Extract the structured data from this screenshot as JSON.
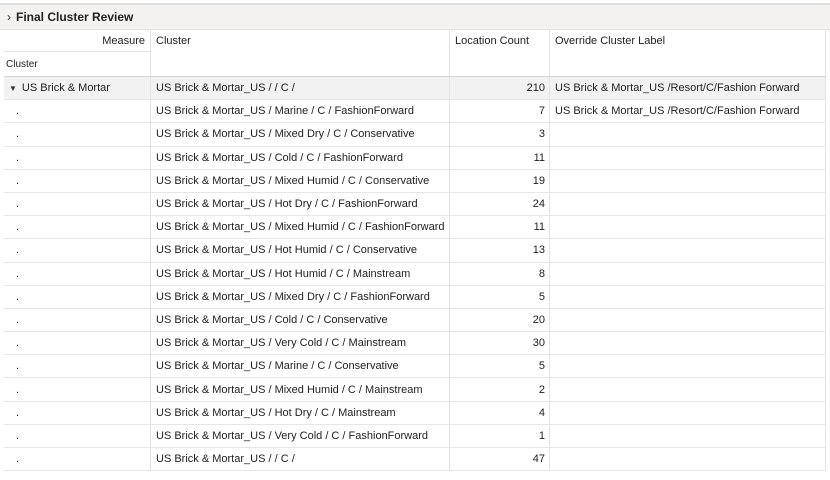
{
  "panel": {
    "chevron_icon": "chevron-right-icon",
    "title": "Final Cluster Review"
  },
  "table": {
    "measure_label": "Measure",
    "row_dim_label": "Cluster",
    "columns": [
      "Cluster",
      "Location Count",
      "Override Cluster Label"
    ],
    "group_label": "US Brick & Mortar",
    "group_toggle_icon": "caret-down-icon",
    "rows": [
      {
        "lead": "",
        "cluster": "US Brick & Mortar_US / / C /",
        "count": "210",
        "override": "US Brick & Mortar_US /Resort/C/Fashion Forward"
      },
      {
        "lead": ".",
        "cluster": "US Brick & Mortar_US / Marine / C / FashionForward",
        "count": "7",
        "override": "US Brick & Mortar_US /Resort/C/Fashion Forward"
      },
      {
        "lead": ".",
        "cluster": "US Brick & Mortar_US / Mixed Dry / C / Conservative",
        "count": "3",
        "override": ""
      },
      {
        "lead": ".",
        "cluster": "US Brick & Mortar_US / Cold / C / FashionForward",
        "count": "11",
        "override": ""
      },
      {
        "lead": ".",
        "cluster": "US Brick & Mortar_US / Mixed Humid / C / Conservative",
        "count": "19",
        "override": ""
      },
      {
        "lead": ".",
        "cluster": "US Brick & Mortar_US / Hot Dry / C / FashionForward",
        "count": "24",
        "override": ""
      },
      {
        "lead": ".",
        "cluster": "US Brick & Mortar_US / Mixed Humid / C / FashionForward",
        "count": "11",
        "override": ""
      },
      {
        "lead": ".",
        "cluster": "US Brick & Mortar_US / Hot Humid / C / Conservative",
        "count": "13",
        "override": ""
      },
      {
        "lead": ".",
        "cluster": "US Brick & Mortar_US / Hot Humid / C / Mainstream",
        "count": "8",
        "override": ""
      },
      {
        "lead": ".",
        "cluster": "US Brick & Mortar_US / Mixed Dry / C / FashionForward",
        "count": "5",
        "override": ""
      },
      {
        "lead": ".",
        "cluster": "US Brick & Mortar_US / Cold / C / Conservative",
        "count": "20",
        "override": ""
      },
      {
        "lead": ".",
        "cluster": "US Brick & Mortar_US / Very Cold / C / Mainstream",
        "count": "30",
        "override": ""
      },
      {
        "lead": ".",
        "cluster": "US Brick & Mortar_US / Marine / C / Conservative",
        "count": "5",
        "override": ""
      },
      {
        "lead": ".",
        "cluster": "US Brick & Mortar_US / Mixed Humid / C / Mainstream",
        "count": "2",
        "override": ""
      },
      {
        "lead": ".",
        "cluster": "US Brick & Mortar_US / Hot Dry / C / Mainstream",
        "count": "4",
        "override": ""
      },
      {
        "lead": ".",
        "cluster": "US Brick & Mortar_US / Very Cold / C / FashionForward",
        "count": "1",
        "override": ""
      },
      {
        "lead": ".",
        "cluster": "US Brick & Mortar_US / / C /",
        "count": "47",
        "override": ""
      }
    ]
  }
}
